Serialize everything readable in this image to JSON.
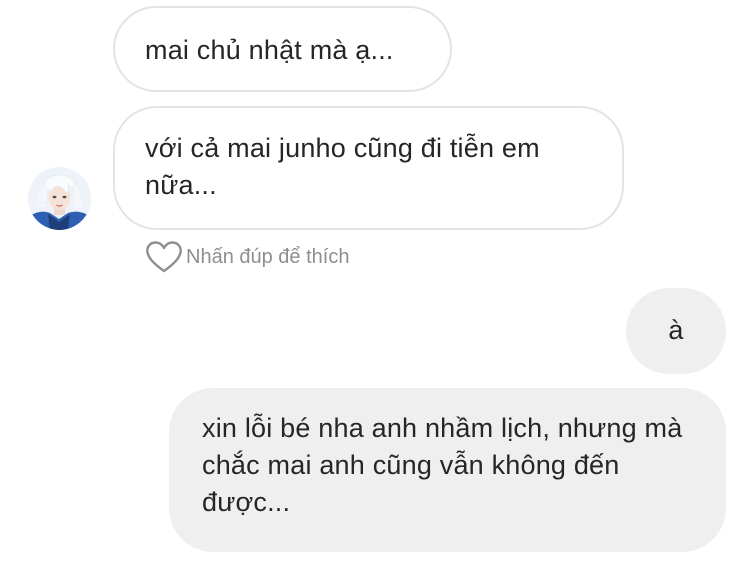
{
  "messages": [
    {
      "from": "them",
      "text": "mai chủ nhật mà ạ..."
    },
    {
      "from": "them",
      "text": "với cả mai junho cũng đi tiễn em nữa..."
    },
    {
      "from": "me",
      "text": "à"
    },
    {
      "from": "me",
      "text": "xin lỗi bé nha anh nhầm lịch, nhưng mà chắc mai anh cũng vẫn không đến được..."
    }
  ],
  "like_hint": "Nhấn đúp để thích",
  "icons": {
    "like": "heart-outline-icon",
    "avatar": "profile-photo"
  },
  "colors": {
    "incoming_bubble_border": "#e3e3e3",
    "outgoing_bubble_bg": "#efefef",
    "hint_text": "#8e8e8e",
    "text": "#262626"
  }
}
